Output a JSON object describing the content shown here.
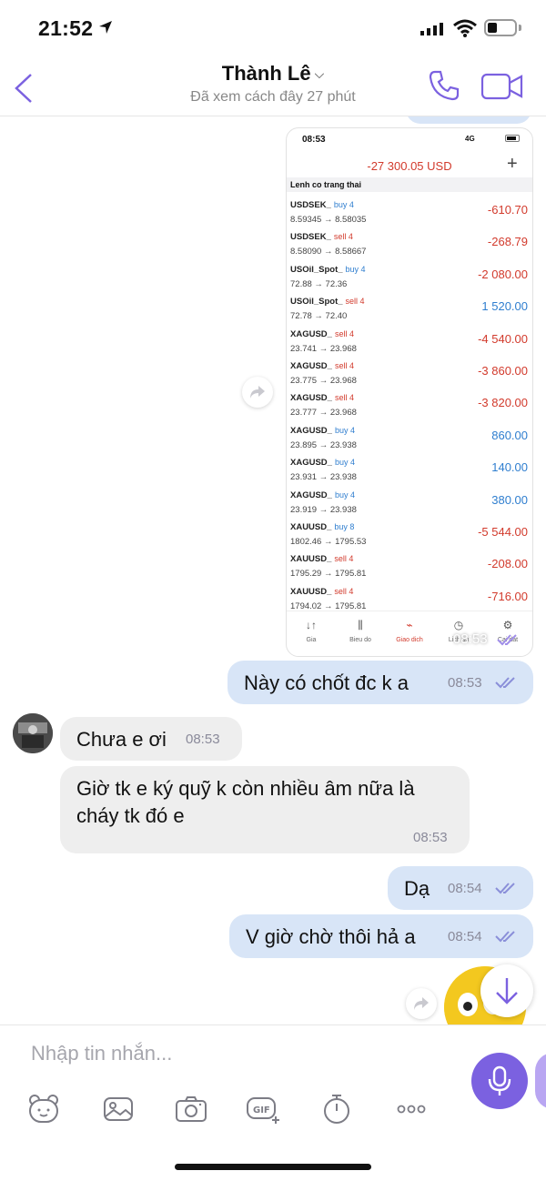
{
  "status": {
    "time": "21:52"
  },
  "header": {
    "contact_name": "Thành Lê",
    "last_seen": "Đã xem cách đây 27 phút"
  },
  "screenshot_message": {
    "status_time": "08:53",
    "network": "4G",
    "balance": "-27 300.05 USD",
    "section_title": "Lenh co trang thai",
    "orders": [
      {
        "symbol": "USDSEK_",
        "side": "buy 4",
        "type": "buy",
        "prices": "8.59345 → 8.58035",
        "pl": "-610.70",
        "sign": "neg"
      },
      {
        "symbol": "USDSEK_",
        "side": "sell 4",
        "type": "sell",
        "prices": "8.58090 → 8.58667",
        "pl": "-268.79",
        "sign": "neg"
      },
      {
        "symbol": "USOil_Spot_",
        "side": "buy 4",
        "type": "buy",
        "prices": "72.88 → 72.36",
        "pl": "-2 080.00",
        "sign": "neg"
      },
      {
        "symbol": "USOil_Spot_",
        "side": "sell 4",
        "type": "sell",
        "prices": "72.78 → 72.40",
        "pl": "1 520.00",
        "sign": "pos"
      },
      {
        "symbol": "XAGUSD_",
        "side": "sell 4",
        "type": "sell",
        "prices": "23.741 → 23.968",
        "pl": "-4 540.00",
        "sign": "neg"
      },
      {
        "symbol": "XAGUSD_",
        "side": "sell 4",
        "type": "sell",
        "prices": "23.775 → 23.968",
        "pl": "-3 860.00",
        "sign": "neg"
      },
      {
        "symbol": "XAGUSD_",
        "side": "sell 4",
        "type": "sell",
        "prices": "23.777 → 23.968",
        "pl": "-3 820.00",
        "sign": "neg"
      },
      {
        "symbol": "XAGUSD_",
        "side": "buy 4",
        "type": "buy",
        "prices": "23.895 → 23.938",
        "pl": "860.00",
        "sign": "pos"
      },
      {
        "symbol": "XAGUSD_",
        "side": "buy 4",
        "type": "buy",
        "prices": "23.931 → 23.938",
        "pl": "140.00",
        "sign": "pos"
      },
      {
        "symbol": "XAGUSD_",
        "side": "buy 4",
        "type": "buy",
        "prices": "23.919 → 23.938",
        "pl": "380.00",
        "sign": "pos"
      },
      {
        "symbol": "XAUUSD_",
        "side": "buy 8",
        "type": "buy",
        "prices": "1802.46 → 1795.53",
        "pl": "-5 544.00",
        "sign": "neg"
      },
      {
        "symbol": "XAUUSD_",
        "side": "sell 4",
        "type": "sell",
        "prices": "1795.29 → 1795.81",
        "pl": "-208.00",
        "sign": "neg"
      },
      {
        "symbol": "XAUUSD_",
        "side": "sell 4",
        "type": "sell",
        "prices": "1794.02 → 1795.81",
        "pl": "-716.00",
        "sign": "neg"
      }
    ],
    "tabs": [
      {
        "label": "Gia",
        "icon": "↓↑"
      },
      {
        "label": "Bieu do",
        "icon": "⫼"
      },
      {
        "label": "Giao dich",
        "icon": "⌁"
      },
      {
        "label": "Lich su",
        "icon": "◷"
      },
      {
        "label": "Cai dat",
        "icon": "⚙"
      }
    ],
    "time": "08:53"
  },
  "messages": [
    {
      "text": "Này có chốt đc k a",
      "time": "08:53"
    },
    {
      "text": "Chưa e ơi",
      "time": "08:53"
    },
    {
      "text_line1": "Giờ tk e ký quỹ k còn nhiều âm nữa là",
      "text_line2": "cháy tk đó e",
      "time": "08:53"
    },
    {
      "text": "Dạ",
      "time": "08:54"
    },
    {
      "text": "V giờ chờ thôi hả a",
      "time": "08:54"
    }
  ],
  "composer": {
    "placeholder": "Nhập tin nhắn..."
  },
  "colors": {
    "accent": "#7b61e0",
    "outgoing_bubble": "#d8e5f7",
    "incoming_bubble": "#eeeeee",
    "loss": "#d23a2c",
    "profit": "#2f7ecf"
  }
}
